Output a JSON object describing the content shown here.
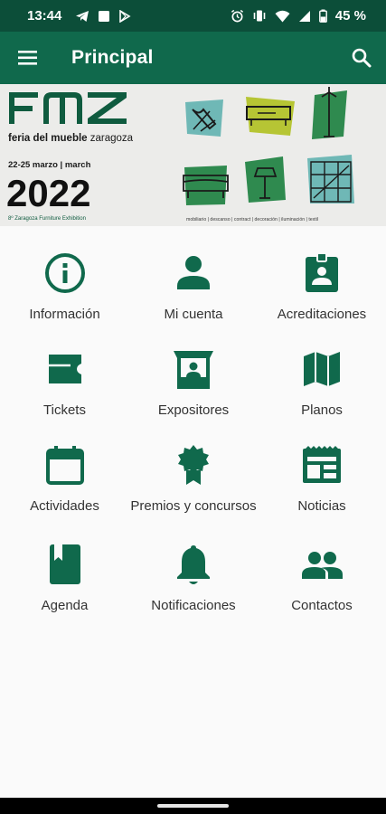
{
  "status_bar": {
    "time": "13:44",
    "battery": "45 %",
    "left_icons": [
      "telegram-icon",
      "message-icon",
      "play-store-icon"
    ],
    "right_icons": [
      "alarm-icon",
      "vibrate-icon",
      "wifi-icon",
      "signal-icon",
      "battery-icon"
    ]
  },
  "app_bar": {
    "title": "Principal",
    "menu_icon": "hamburger-menu-icon",
    "search_icon": "search-icon",
    "color": "#10694c",
    "status_color": "#0c4e39"
  },
  "banner": {
    "logo": "FMZ",
    "subtitle_bold": "feria del mueble",
    "subtitle_light": "zaragoza",
    "dates": "22-25 marzo | march",
    "year": "2022",
    "edition": "8º Zaragoza Furniture Exhibition",
    "tags": "mobiliario | descanso | contract | decoración | iluminación | textil"
  },
  "menu": {
    "items": [
      {
        "label": "Información",
        "icon": "info-icon"
      },
      {
        "label": "Mi cuenta",
        "icon": "person-icon"
      },
      {
        "label": "Acreditaciones",
        "icon": "badge-icon"
      },
      {
        "label": "Tickets",
        "icon": "ticket-icon"
      },
      {
        "label": "Expositores",
        "icon": "exhibitor-stand-icon"
      },
      {
        "label": "Planos",
        "icon": "map-icon"
      },
      {
        "label": "Actividades",
        "icon": "calendar-icon"
      },
      {
        "label": "Premios y concursos",
        "icon": "award-icon"
      },
      {
        "label": "Noticias",
        "icon": "newspaper-icon"
      },
      {
        "label": "Agenda",
        "icon": "bookmark-book-icon"
      },
      {
        "label": "Notificaciones",
        "icon": "bell-icon"
      },
      {
        "label": "Contactos",
        "icon": "people-icon"
      }
    ]
  },
  "colors": {
    "accent": "#10694c",
    "banner_teal": "#6fb8b6",
    "banner_lime": "#b6c534",
    "banner_green": "#2f8a4f"
  }
}
